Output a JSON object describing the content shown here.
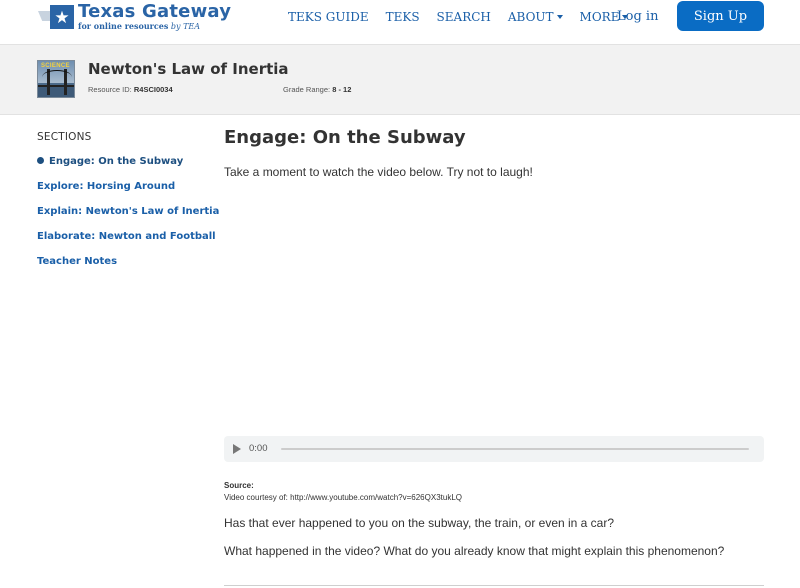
{
  "logo": {
    "title": "Texas Gateway",
    "subtitle": "for online resources",
    "subtitle_by": "by TEA"
  },
  "nav": {
    "items": [
      {
        "label": "TEKS GUIDE",
        "dropdown": false
      },
      {
        "label": "TEKS",
        "dropdown": false
      },
      {
        "label": "SEARCH",
        "dropdown": false
      },
      {
        "label": "ABOUT",
        "dropdown": true
      },
      {
        "label": "MORE",
        "dropdown": true
      }
    ],
    "login": "Log in",
    "signup": "Sign Up"
  },
  "resource": {
    "thumbnail_label": "SCIENCE",
    "title": "Newton's Law of Inertia",
    "id_label": "Resource ID:",
    "id_value": "R4SCI0034",
    "grade_label": "Grade Range:",
    "grade_value": "8 - 12"
  },
  "sidebar": {
    "heading": "SECTIONS",
    "items": [
      {
        "label": "Engage: On the Subway",
        "active": true
      },
      {
        "label": "Explore: Horsing Around",
        "active": false
      },
      {
        "label": "Explain: Newton's Law of Inertia",
        "active": false
      },
      {
        "label": "Elaborate: Newton and Football",
        "active": false
      },
      {
        "label": "Teacher Notes",
        "active": false
      }
    ]
  },
  "main": {
    "title": "Engage: On the Subway",
    "intro": "Take a moment to watch the video below. Try not to laugh!",
    "player": {
      "time": "0:00",
      "progress": 0
    },
    "source_label": "Source:",
    "source_text": "Video courtesy of: http://www.youtube.com/watch?v=626QX3tukLQ",
    "question1": "Has that ever happened to you on the subway, the train, or even in a car?",
    "question2": "What happened in the video? What do you already know that might explain this phenomenon?"
  },
  "colors": {
    "brand_blue": "#2a64a6",
    "link_blue": "#1a5fa8",
    "button_blue": "#0a6cc4",
    "band_gray": "#f2f2f2"
  }
}
